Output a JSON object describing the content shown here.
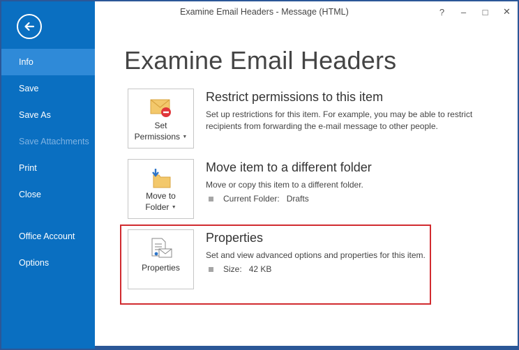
{
  "window": {
    "title": "Examine Email Headers  -  Message (HTML)",
    "controls": {
      "help": "?",
      "minimize": "–",
      "maximize": "□",
      "close": "✕"
    }
  },
  "sidebar": {
    "items": [
      {
        "label": "Info",
        "active": true
      },
      {
        "label": "Save"
      },
      {
        "label": "Save As"
      },
      {
        "label": "Save Attachments",
        "disabled": true
      },
      {
        "label": "Print"
      },
      {
        "label": "Close"
      },
      {
        "label": "Office Account"
      },
      {
        "label": "Options"
      }
    ]
  },
  "page": {
    "title": "Examine Email Headers"
  },
  "sections": {
    "permissions": {
      "tile_line1": "Set",
      "tile_line2": "Permissions",
      "heading": "Restrict permissions to this item",
      "description": "Set up restrictions for this item. For example, you may be able to restrict recipients from forwarding the e-mail message to other people."
    },
    "move": {
      "tile_line1": "Move to",
      "tile_line2": "Folder",
      "heading": "Move item to a different folder",
      "description": "Move or copy this item to a different folder.",
      "detail_label": "Current Folder:",
      "detail_value": "Drafts"
    },
    "properties": {
      "tile_label": "Properties",
      "heading": "Properties",
      "description": "Set and view advanced options and properties for this item.",
      "detail_label": "Size:",
      "detail_value": "42 KB"
    }
  },
  "colors": {
    "sidebar": "#0a6fc1",
    "sidebar_active": "#2f8ad8",
    "highlight": "#d12b2f"
  }
}
